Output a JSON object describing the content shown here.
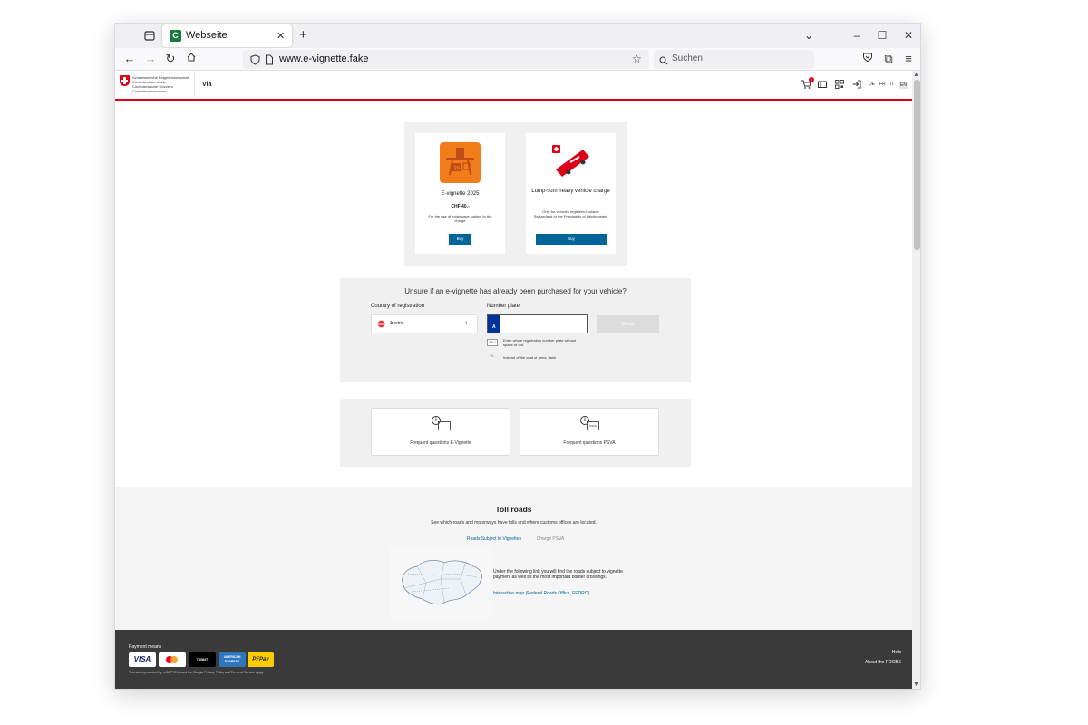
{
  "browser": {
    "tab_title": "Webseite",
    "favicon_letter": "C",
    "url": "www.e-vignette.fake",
    "search_placeholder": "Suchen"
  },
  "header": {
    "confederation": [
      "Schweizerische Eidgenossenschaft",
      "Confédération suisse",
      "Confederazione Svizzera",
      "Confederaziun svizra"
    ],
    "site_name": "Via",
    "cart_count": "1",
    "languages": [
      "DE",
      "FR",
      "IT",
      "EN"
    ],
    "active_language": "EN"
  },
  "products": [
    {
      "title": "E-vignette 2025",
      "price": "CHF 40.-",
      "description": "For the use of motorways subject to the charge",
      "button": "Buy",
      "icon_color": "#f07d19"
    },
    {
      "title": "Lump-sum heavy vehicle charge",
      "description": "Only for vehicles registered outside Switzerland or the Principality of Liechtenstein",
      "button": "Buy",
      "icon_color": "#dc0018"
    }
  ],
  "check": {
    "title": "Unsure if an e-vignette has already been purchased for your vehicle?",
    "country_label": "Country of registration",
    "country_value": "Austria",
    "plate_label": "Number plate",
    "plate_prefix": "A",
    "plate_value": "",
    "check_button": "Check",
    "hint_1": "Enter whole registration number plate without space or dot.",
    "hint_2": "Instead of the coat of arms: dash"
  },
  "faq": [
    {
      "label": "Frequent questions E-Vignette"
    },
    {
      "label": "Frequent questions PSVA"
    }
  ],
  "toll": {
    "title": "Toll roads",
    "subtitle": "See which roads and motorways have tolls and where customs offices are located.",
    "tabs": [
      "Roads Subject to Vignettes",
      "Charge PSVA"
    ],
    "active_tab": "Roads Subject to Vignettes",
    "text": "Under the following link you will find the roads subject to vignette payment as well as the most important border crossings.",
    "link": "Interactive map (Federal Roads Office, FEDRO)"
  },
  "footer": {
    "payment_label": "Payment means",
    "payment_methods": [
      "VISA",
      "Mastercard",
      "TWINT",
      "AMERICAN EXPRESS",
      "PFPay"
    ],
    "recaptcha": "This site is protected by reCAPTCHA and the Google Privacy Policy and Terms of Service apply.",
    "links": [
      "Help",
      "About the FOCBS"
    ]
  }
}
